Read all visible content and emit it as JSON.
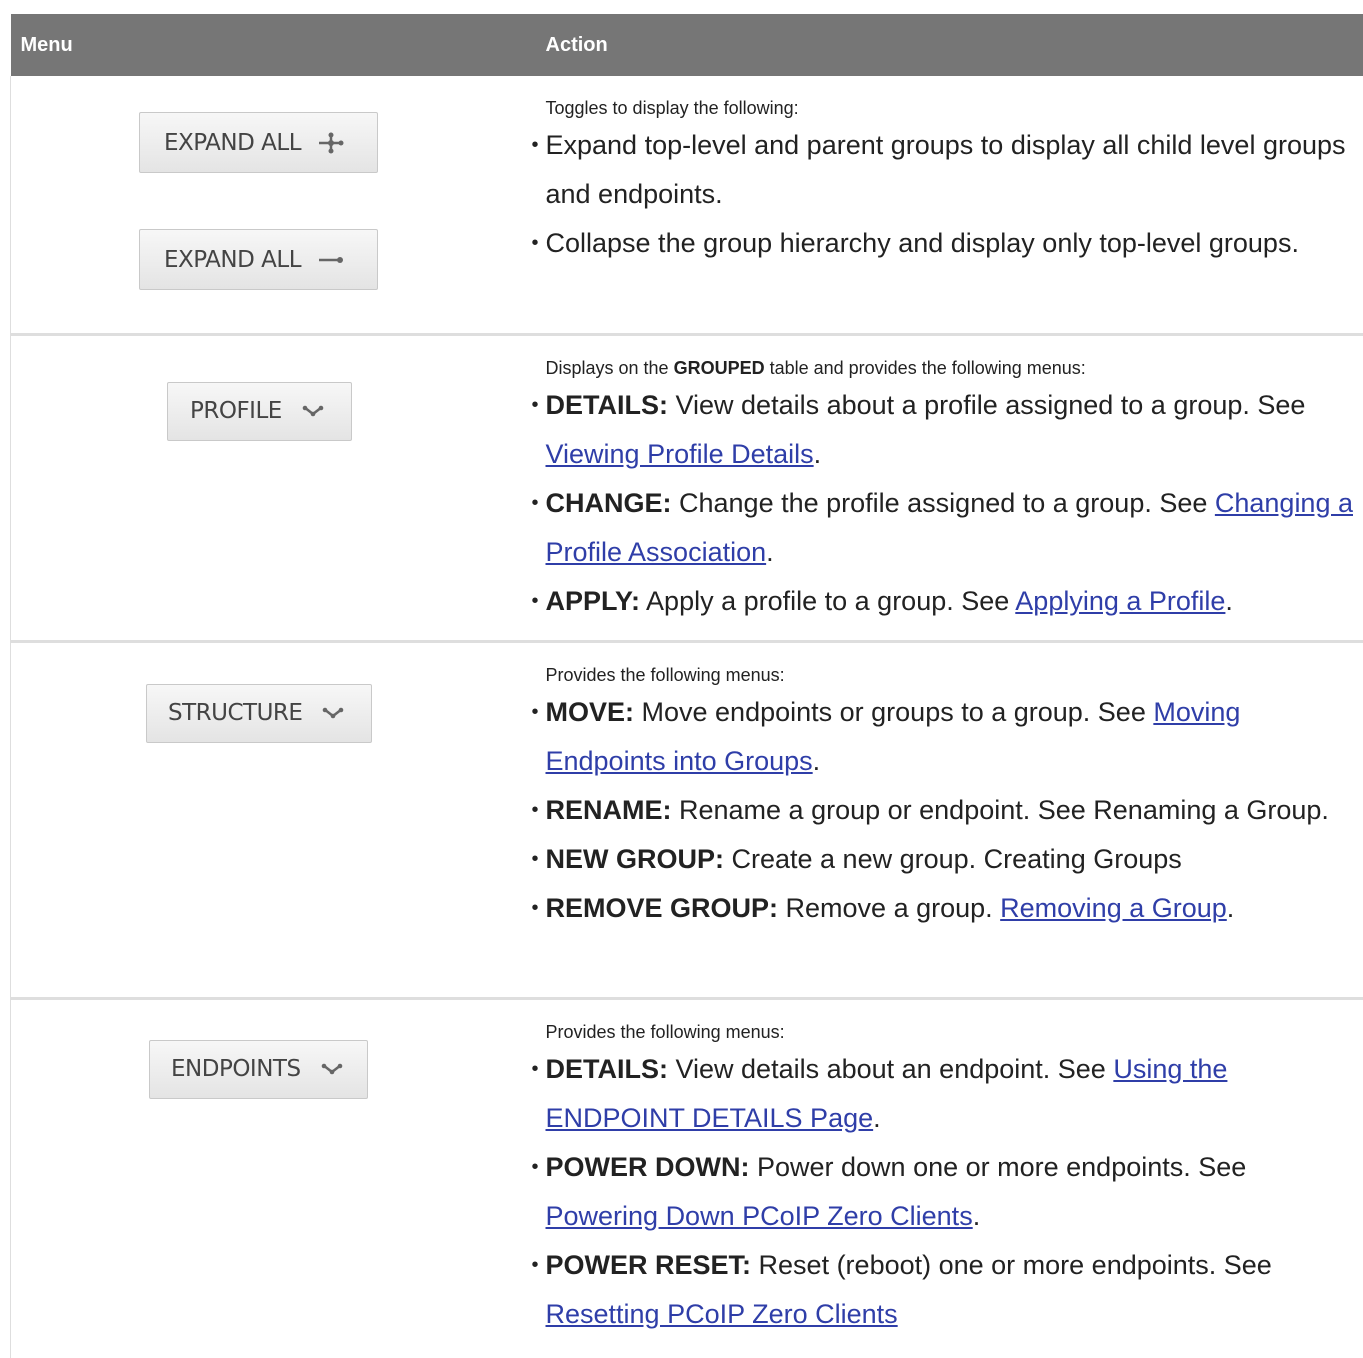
{
  "header": {
    "menu": "Menu",
    "action": "Action"
  },
  "rows": [
    {
      "buttons": [
        {
          "label": "EXPAND ALL",
          "icon": "expand-icon"
        },
        {
          "label": "EXPAND ALL",
          "icon": "collapse-icon"
        }
      ],
      "intro": "Toggles to display the following:",
      "items": [
        {
          "text": "Expand top-level and parent groups to display all child level groups and endpoints."
        },
        {
          "text": "Collapse the group hierarchy and display only top-level groups."
        }
      ]
    },
    {
      "buttons": [
        {
          "label": "PROFILE",
          "icon": "chevron-down-icon"
        }
      ],
      "intro_pre": "Displays on the ",
      "intro_bold": "GROUPED",
      "intro_post": " table and provides the following menus:",
      "items": [
        {
          "bold": "DETAILS:",
          "text": " View details about a profile assigned to a group. See ",
          "link": "Viewing Profile Details",
          "after": "."
        },
        {
          "bold": "CHANGE:",
          "text": " Change the profile assigned to a group. See ",
          "link": "Changing a Profile Association",
          "after": "."
        },
        {
          "bold": "APPLY:",
          "text": " Apply a profile to a group. See ",
          "link": "Applying a Profile",
          "after": "."
        }
      ]
    },
    {
      "buttons": [
        {
          "label": "STRUCTURE",
          "icon": "chevron-down-icon"
        }
      ],
      "intro": "Provides the following menus:",
      "items": [
        {
          "bold": "MOVE:",
          "text": " Move endpoints or groups to a group. See ",
          "link": "Moving Endpoints into Groups",
          "after": "."
        },
        {
          "bold": "RENAME:",
          "text": " Rename a group or endpoint. See Renaming a Group."
        },
        {
          "bold": "NEW GROUP:",
          "text": " Create a new group. Creating Groups"
        },
        {
          "bold": "REMOVE GROUP:",
          "text": " Remove a group. ",
          "link": "Removing a Group",
          "after": "."
        }
      ]
    },
    {
      "buttons": [
        {
          "label": "ENDPOINTS",
          "icon": "chevron-down-icon"
        }
      ],
      "intro": "Provides the following menus:",
      "items": [
        {
          "bold": "DETAILS:",
          "text": " View details about an endpoint. See ",
          "link": "Using the ENDPOINT DETAILS Page",
          "after": "."
        },
        {
          "bold": "POWER DOWN:",
          "text": " Power down one or more endpoints. See ",
          "link": "Powering Down PCoIP Zero Clients",
          "after": "."
        },
        {
          "bold": "POWER RESET:",
          "text": " Reset (reboot) one or more endpoints. See ",
          "link": "Resetting PCoIP Zero Clients"
        }
      ]
    }
  ]
}
